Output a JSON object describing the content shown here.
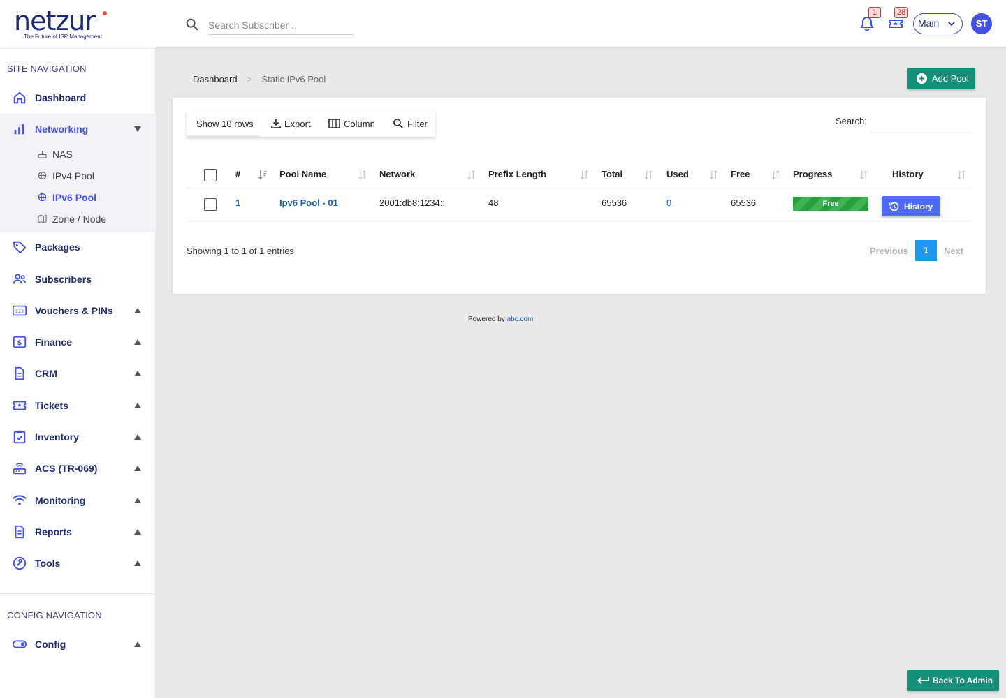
{
  "brand": {
    "name": "netzur",
    "tagline": "The Future of ISP Management",
    "primary": "#1d2b6b",
    "accent": "#4250e4",
    "teal": "#14907a"
  },
  "header": {
    "search_placeholder": "Search Subscriber ..",
    "notifications_count": "1",
    "tickets_count": "28",
    "branch_select": "Main",
    "user_initials": "ST"
  },
  "sidebar": {
    "site_section": "SITE NAVIGATION",
    "config_section": "CONFIG NAVIGATION",
    "items": {
      "dashboard": "Dashboard",
      "networking": "Networking",
      "packages": "Packages",
      "subscribers": "Subscribers",
      "vouchers": "Vouchers & PINs",
      "finance": "Finance",
      "crm": "CRM",
      "tickets": "Tickets",
      "inventory": "Inventory",
      "acs": "ACS (TR-069)",
      "monitoring": "Monitoring",
      "reports": "Reports",
      "tools": "Tools",
      "config": "Config"
    },
    "networking_sub": {
      "nas": "NAS",
      "ipv4": "IPv4 Pool",
      "ipv6": "IPv6 Pool",
      "zone": "Zone / Node"
    }
  },
  "breadcrumb": {
    "home": "Dashboard",
    "separator": ">",
    "current": "Static IPv6 Pool"
  },
  "actions": {
    "add_pool": "Add Pool"
  },
  "toolbar": {
    "show_rows": "Show 10 rows",
    "export": "Export",
    "column": "Column",
    "filter": "Filter",
    "search_label": "Search:"
  },
  "table": {
    "columns": {
      "num": "#",
      "pool_name": "Pool Name",
      "network": "Network",
      "prefix": "Prefix Length",
      "total": "Total",
      "used": "Used",
      "free": "Free",
      "progress": "Progress",
      "history": "History"
    },
    "rows": [
      {
        "num": "1",
        "pool_name": "Ipv6 Pool - 01",
        "network": "2001:db8:1234::",
        "prefix": "48",
        "total": "65536",
        "used": "0",
        "free": "65536",
        "progress_label": "Free",
        "history_label": "History"
      }
    ]
  },
  "pagination": {
    "summary": "Showing 1 to 1 of 1 entries",
    "previous": "Previous",
    "current_page": "1",
    "next": "Next"
  },
  "footer": {
    "prefix": "Powered by",
    "link": "abc.com"
  },
  "back_admin": "Back To Admin"
}
